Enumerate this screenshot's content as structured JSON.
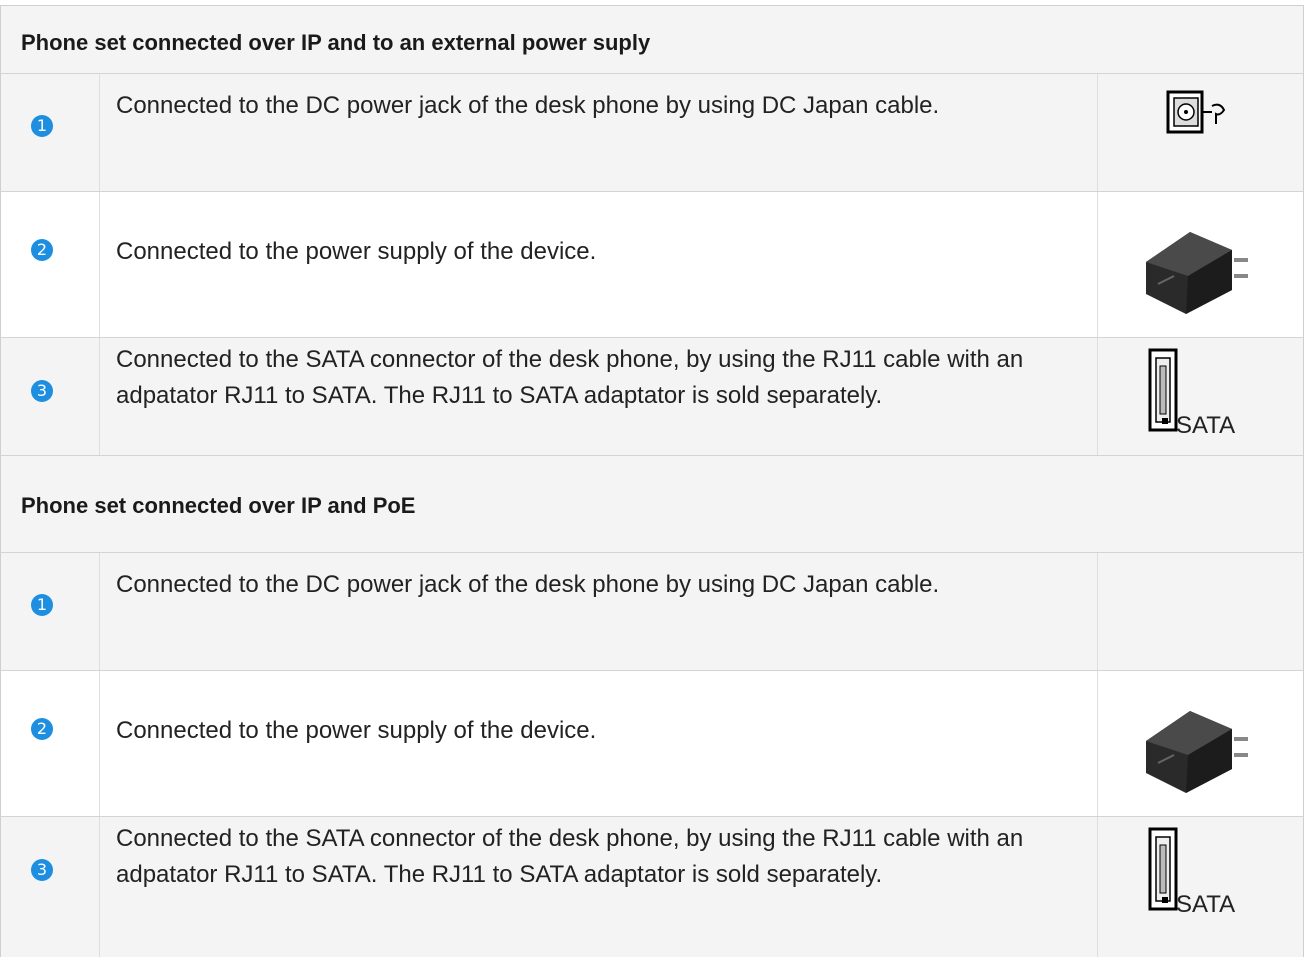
{
  "sections": [
    {
      "title": "Phone set connected over IP and to an external power suply",
      "rows": [
        {
          "number": "1",
          "text": "Connected to the DC power jack of the desk phone by using DC Japan cable.",
          "image": "dc-jack-icon"
        },
        {
          "number": "2",
          "text": "Connected to the power supply of the device.",
          "image": "power-adapter-icon"
        },
        {
          "number": "3",
          "text": "Connected to the SATA connector of the desk phone, by using the RJ11 cable with an adpatator RJ11 to SATA. The RJ11 to SATA adaptator is sold separately.",
          "image": "sata-connector-icon",
          "image_label": "SATA"
        }
      ]
    },
    {
      "title": "Phone set connected over IP and PoE",
      "rows": [
        {
          "number": "1",
          "text": "Connected to the DC power jack of the desk phone by using DC Japan cable.",
          "image": ""
        },
        {
          "number": "2",
          "text": "Connected to the power supply of the device.",
          "image": "power-adapter-icon"
        },
        {
          "number": "3",
          "text": "Connected to the SATA connector of the desk phone, by using the RJ11 cable with an adpatator RJ11 to SATA. The RJ11 to SATA adaptator is sold separately.",
          "image": "sata-connector-icon",
          "image_label": "SATA"
        }
      ]
    }
  ],
  "colors": {
    "number_badge": "#1e8fe0",
    "row_shade": "#f4f4f4",
    "border": "#d4d4d4"
  }
}
